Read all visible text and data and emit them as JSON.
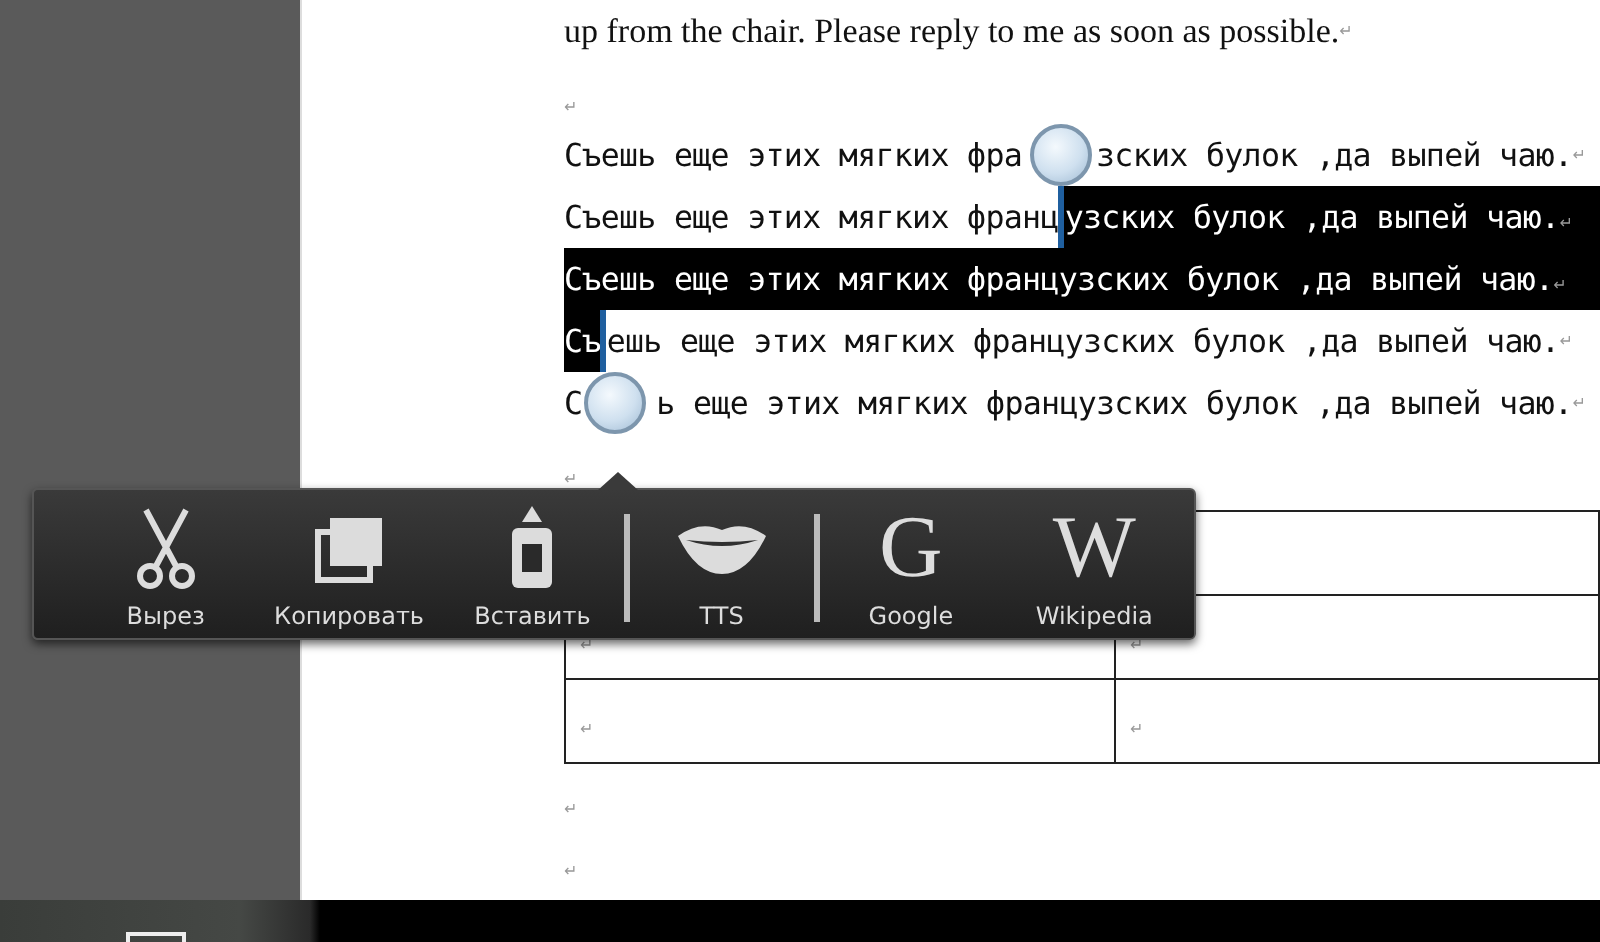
{
  "document": {
    "blocks": [
      {
        "kind": "serif",
        "segments": [
          {
            "text": "up from the chair. Please reply to me as soon as possible.",
            "selected": false
          }
        ],
        "mark": "↵"
      },
      {
        "kind": "empty",
        "mark": "↵"
      },
      {
        "kind": "mono",
        "segments": [
          {
            "text": "Съешь еще этих мягких фра",
            "selected": false
          },
          {
            "text": "зских булок ,да выпей чаю.",
            "selected": false,
            "gap_before": true
          }
        ],
        "mark": "↵"
      },
      {
        "kind": "mono",
        "segments": [
          {
            "text": "Съешь еще этих мягких франц",
            "selected": false
          },
          {
            "text": "узских булок ,да выпей чаю.",
            "selected": true
          }
        ],
        "mark": "↵"
      },
      {
        "kind": "mono",
        "segments": [
          {
            "text": "Съешь еще этих мягких французских булок ,да выпей чаю.",
            "selected": true
          }
        ],
        "mark": "↵"
      },
      {
        "kind": "mono",
        "segments": [
          {
            "text": "Съ",
            "selected": true
          },
          {
            "text": "ешь еще этих мягких французских булок ,да выпей чаю.",
            "selected": false
          }
        ],
        "mark": "↵"
      },
      {
        "kind": "mono",
        "segments": [
          {
            "text": "С",
            "selected": false
          },
          {
            "text": "ь еще этих мягких французских булок ,да выпей чаю.",
            "selected": false,
            "gap_before": true
          }
        ],
        "mark": "↵"
      },
      {
        "kind": "empty",
        "mark": "↵"
      },
      {
        "kind": "table",
        "rows": [
          [
            {},
            {}
          ],
          [
            {
              "mark": "↵"
            },
            {
              "mark": "↵"
            }
          ],
          [
            {
              "mark": "↵"
            },
            {
              "mark": "↵"
            }
          ]
        ]
      },
      {
        "kind": "empty",
        "mark": "↵"
      },
      {
        "kind": "empty",
        "mark": "↵"
      }
    ]
  },
  "selection_menu": {
    "items": [
      {
        "kind": "tool",
        "label": "Вырез"
      },
      {
        "kind": "tool",
        "label": "Копировать"
      },
      {
        "kind": "tool",
        "label": "Вставить"
      },
      {
        "kind": "divider"
      },
      {
        "kind": "tool",
        "label": "TTS"
      },
      {
        "kind": "divider"
      },
      {
        "kind": "tool",
        "label": "Google",
        "glyph": "G"
      },
      {
        "kind": "tool",
        "label": "Wikipedia",
        "glyph": "W"
      }
    ]
  }
}
